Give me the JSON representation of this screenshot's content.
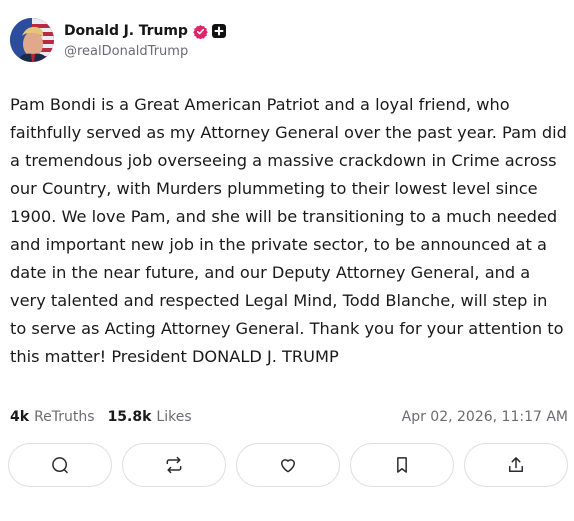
{
  "author": {
    "display_name": "Donald J. Trump",
    "handle": "@realDonaldTrump",
    "verified_badge_color": "#e1226b"
  },
  "post": {
    "text": "Pam Bondi is a Great American Patriot and a loyal friend, who faithfully served as my Attorney General over the past year. Pam did a tremendous job overseeing a massive crackdown in Crime across our Country, with Murders plummeting to their lowest level since 1900. We love Pam, and she will be transitioning to a much needed and important new job in the private sector, to be announced at a date in the near future, and our Deputy Attorney General, and a very talented and respected Legal Mind, Todd Blanche, will step in to serve as Acting Attorney General. Thank you for your attention to this matter! President DONALD J. TRUMP",
    "timestamp": "Apr 02, 2026, 11:17 AM"
  },
  "stats": {
    "retruths_count": "4k",
    "retruths_label": "ReTruths",
    "likes_count": "15.8k",
    "likes_label": "Likes"
  },
  "actions": [
    {
      "icon": "reply-icon"
    },
    {
      "icon": "retruth-icon"
    },
    {
      "icon": "like-heart-icon"
    },
    {
      "icon": "bookmark-icon"
    },
    {
      "icon": "share-icon"
    }
  ]
}
